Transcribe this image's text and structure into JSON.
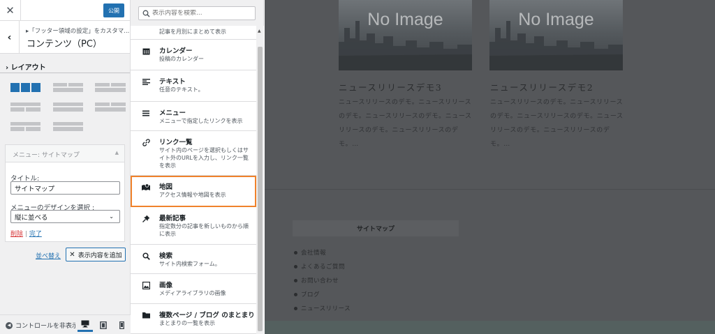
{
  "customizer": {
    "publish_label": "公開",
    "breadcrumb": "▸「フッター領域の設定」をカスタマ...",
    "section_title": "コンテンツ（PC）",
    "layout_title": "レイアウト",
    "widget": {
      "header_title": "メニュー: サイトマップ",
      "title_label": "タイトル:",
      "title_value": "サイトマップ",
      "design_label": "メニューのデザインを選択 :",
      "design_value": "縦に並べる",
      "delete_label": "削除",
      "separator": "|",
      "done_label": "完了"
    },
    "reorder_label": "並べ替え",
    "add_widget_label": "表示内容を追加",
    "hide_controls_label": "コントロールを非表示"
  },
  "picker": {
    "search_placeholder": "表示内容を検索...",
    "partial_desc": "記事を月別にまとめて表示",
    "items": [
      {
        "title": "カレンダー",
        "desc": "投稿のカレンダー",
        "icon": "calendar-icon"
      },
      {
        "title": "テキスト",
        "desc": "任意のテキスト。",
        "icon": "text-icon"
      },
      {
        "title": "メニュー",
        "desc": "メニューで指定したリンクを表示",
        "icon": "menu-icon"
      },
      {
        "title": "リンク一覧",
        "desc": "サイト内のページを選択もしくはサイト外のURLを入力し、リンク一覧を表示",
        "icon": "link-icon"
      },
      {
        "title": "地図",
        "desc": "アクセス情報や地図を表示",
        "icon": "map-icon"
      },
      {
        "title": "最新記事",
        "desc": "指定数分の記事を新しいものから順に表示",
        "icon": "pin-icon"
      },
      {
        "title": "検索",
        "desc": "サイト内検索フォーム。",
        "icon": "search-icon"
      },
      {
        "title": "画像",
        "desc": "メディアライブラリの画像",
        "icon": "image-icon"
      },
      {
        "title": "複数ページ / ブログ のまとまり",
        "desc": "まとまりの一覧を表示",
        "icon": "folder-icon"
      }
    ]
  },
  "preview": {
    "no_image": "No Image",
    "posts": [
      {
        "title": "ニュースリリースデモ3",
        "excerpt": "ニュースリリースのデモ。ニュースリリースのデモ。ニュースリリースのデモ。ニュースリリースのデモ。ニュースリリースのデモ。…"
      },
      {
        "title": "ニュースリリースデモ2",
        "excerpt": "ニュースリリースのデモ。ニュースリリースのデモ。ニュースリリースのデモ。ニュースリリースのデモ。ニュースリリースのデモ。…"
      }
    ],
    "sitemap_title": "サイトマップ",
    "sitemap_items": [
      "会社情報",
      "よくあるご質問",
      "お問い合わせ",
      "ブログ",
      "ニュースリリース"
    ]
  },
  "colors": {
    "accent": "#2271b1",
    "highlight": "#f0822b",
    "delete": "#d63638"
  }
}
